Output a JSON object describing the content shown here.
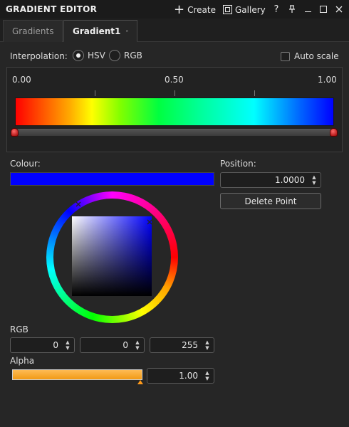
{
  "window": {
    "title": "GRADIENT EDITOR",
    "create_label": "Create",
    "gallery_label": "Gallery",
    "help_label": "?"
  },
  "tabs": [
    {
      "label": "Gradients",
      "active": false
    },
    {
      "label": "Gradient1",
      "active": true
    }
  ],
  "interpolation": {
    "label": "Interpolation:",
    "options": [
      {
        "label": "HSV",
        "selected": true
      },
      {
        "label": "RGB",
        "selected": false
      }
    ],
    "auto_scale_label": "Auto scale",
    "auto_scale_checked": false
  },
  "gradient": {
    "scale_labels": [
      "0.00",
      "0.50",
      "1.00"
    ],
    "stops": [
      0.0,
      1.0
    ]
  },
  "colour": {
    "label": "Colour:",
    "value": "#0000ff"
  },
  "position": {
    "label": "Position:",
    "value": "1.0000"
  },
  "delete_point_label": "Delete Point",
  "rgb": {
    "label": "RGB",
    "r": "0",
    "g": "0",
    "b": "255"
  },
  "alpha": {
    "label": "Alpha",
    "value": "1.00",
    "level": 1.0
  },
  "colors": {
    "background": "#262626",
    "alpha_fill": "#f29a16",
    "stop_marker": "#c00000"
  }
}
